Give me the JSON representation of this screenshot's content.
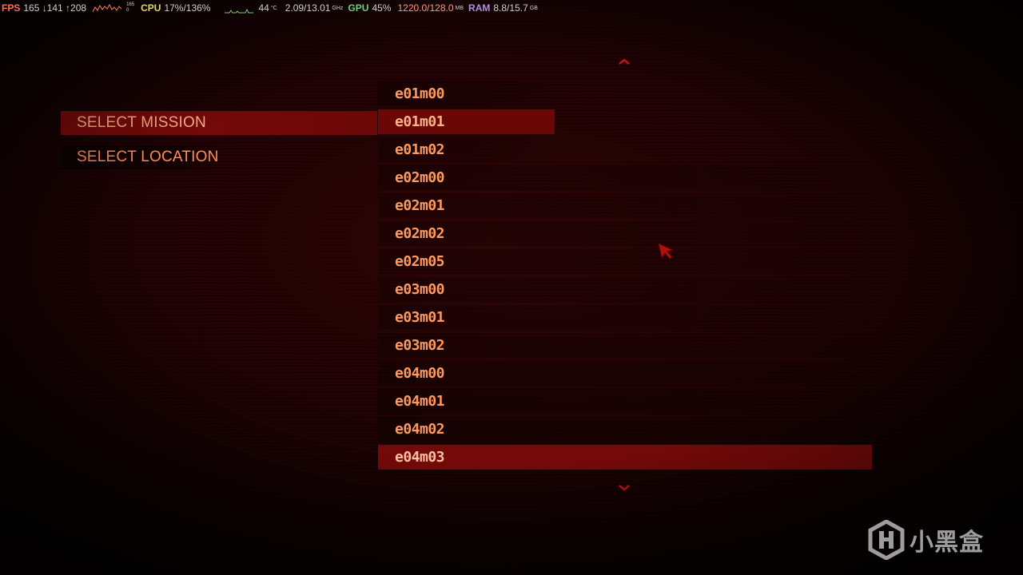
{
  "overlay": {
    "fps_label": "FPS",
    "fps_values": "165 ↓141 ↑208",
    "fps_cap": "165",
    "fps_min": "0",
    "cpu_label": "CPU",
    "cpu_value": "17%/136%",
    "cpu_temp": "44",
    "cpu_temp_unit": "°C",
    "cpu_clock": "2.09/13.01",
    "cpu_clock_unit": "GHz",
    "gpu_label": "GPU",
    "gpu_value": "45%",
    "vram_value": "1220.0/128.0",
    "vram_unit": "MB",
    "ram_label": "RAM",
    "ram_value": "8.8/15.7",
    "ram_unit": "GB",
    "colors": {
      "fps": "#ff6a5a",
      "cpu": "#e8d66a",
      "gpu": "#6fd27a",
      "ram": "#b08de6"
    }
  },
  "menu": {
    "items": [
      {
        "label": "SELECT MISSION",
        "selected": true
      },
      {
        "label": "SELECT LOCATION",
        "selected": false
      }
    ]
  },
  "missions": {
    "items": [
      {
        "label": "e01m00"
      },
      {
        "label": "e01m01"
      },
      {
        "label": "e01m02"
      },
      {
        "label": "e02m00"
      },
      {
        "label": "e02m01"
      },
      {
        "label": "e02m02"
      },
      {
        "label": "e02m05"
      },
      {
        "label": "e03m00"
      },
      {
        "label": "e03m01"
      },
      {
        "label": "e03m02"
      },
      {
        "label": "e04m00"
      },
      {
        "label": "e04m01"
      },
      {
        "label": "e04m02"
      },
      {
        "label": "e04m03"
      }
    ],
    "hovered": "e01m01",
    "selected": "e04m03"
  },
  "watermark": {
    "text": "小黑盒"
  },
  "icons": {
    "scroll_up": "chevron-up-icon",
    "scroll_down": "chevron-down-icon",
    "cursor": "mouse-cursor-icon",
    "watermark_logo": "heybox-logo-icon"
  },
  "theme": {
    "accent": "#7a0a0a",
    "text": "#ff8f57",
    "background": "#1c0203"
  }
}
